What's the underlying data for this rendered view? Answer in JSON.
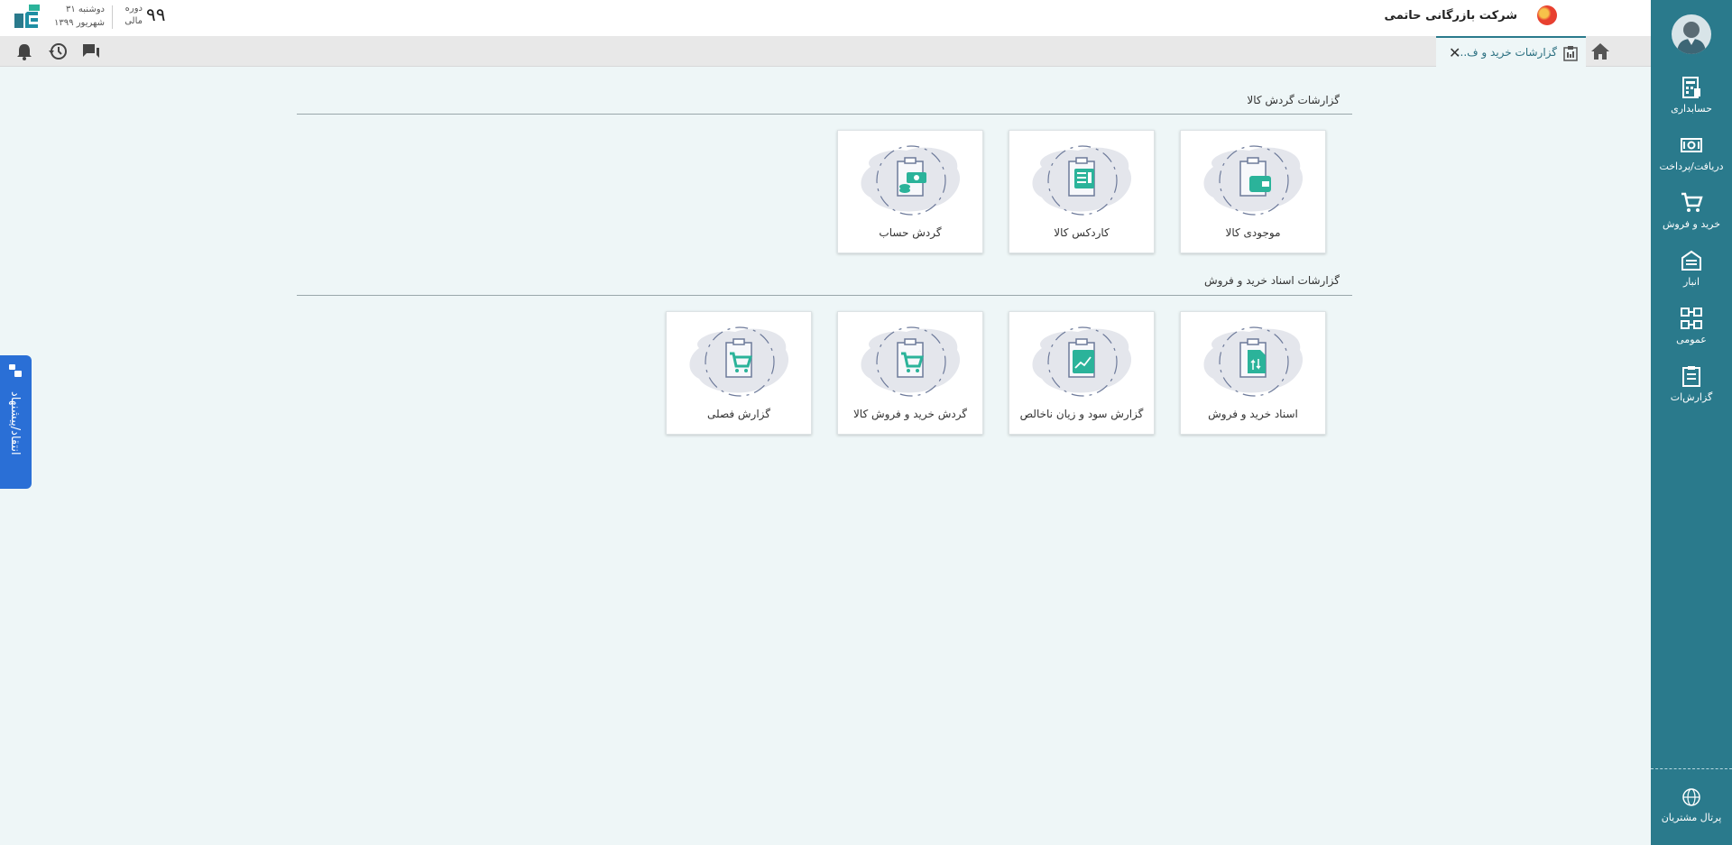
{
  "header": {
    "company_name": "شرکت بازرگانی حاتمی",
    "fiscal_period_number": "۹۹",
    "fiscal_period_label_line1": "دوره",
    "fiscal_period_label_line2": "مالی",
    "date_line1": "دوشنبه ۳۱",
    "date_line2": "شهریور ۱۳۹۹"
  },
  "tabs": [
    {
      "label": "گزارشات خرید و ف...",
      "active": true
    }
  ],
  "toolbar_icons": [
    "messages-icon",
    "history-icon",
    "notifications-icon"
  ],
  "sidebar": {
    "items": [
      {
        "label": "حسابداری",
        "icon": "accounting-icon"
      },
      {
        "label": "دریافت/پرداخت",
        "icon": "payment-icon"
      },
      {
        "label": "خرید و فروش",
        "icon": "cart-icon"
      },
      {
        "label": "انبار",
        "icon": "warehouse-icon"
      },
      {
        "label": "عمومی",
        "icon": "general-icon"
      },
      {
        "label": "گزارش‌ات",
        "icon": "reports-icon"
      }
    ],
    "portal_label": "پرتال مشتریان"
  },
  "feedback": {
    "label": "انتقاد/پیشنهاد"
  },
  "sections": [
    {
      "title": "گزارشات گردش کالا",
      "cards": [
        {
          "label": "موجودی کالا",
          "icon": "wallet-icon"
        },
        {
          "label": "کاردکس کالا",
          "icon": "list-icon"
        },
        {
          "label": "گردش حساب",
          "icon": "money-icon"
        }
      ]
    },
    {
      "title": "گزارشات اسناد خرید و فروش",
      "cards": [
        {
          "label": "اسناد خرید و فروش",
          "icon": "document-icon"
        },
        {
          "label": "گزارش سود و زیان ناخالص",
          "icon": "chart-icon"
        },
        {
          "label": "گردش خرید و فروش کالا",
          "icon": "cart-icon"
        },
        {
          "label": "گزارش فصلی",
          "icon": "cart-icon"
        }
      ]
    }
  ],
  "colors": {
    "sidebar": "#2a7a8c",
    "accent": "#2bb39a",
    "feedback": "#2a6fd6",
    "background": "#eef6f7"
  }
}
